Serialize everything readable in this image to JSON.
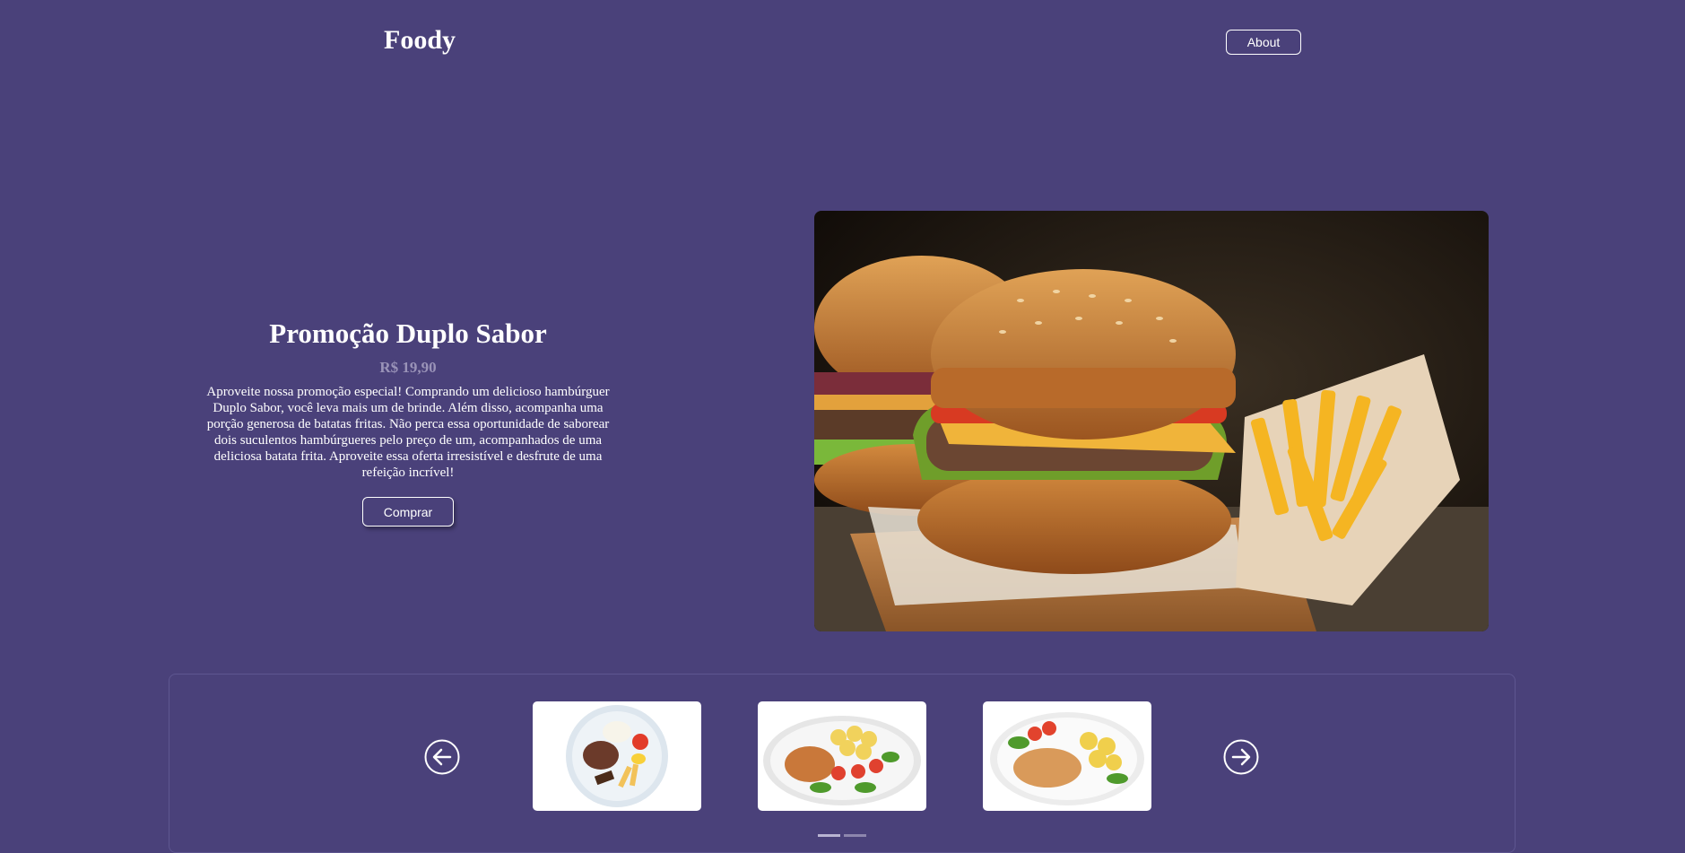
{
  "header": {
    "logo": "Foody",
    "about_label": "About"
  },
  "promo": {
    "title": "Promoção Duplo Sabor",
    "price": "R$ 19,90",
    "description": "Aproveite nossa promoção especial! Comprando um delicioso hambúrguer Duplo Sabor, você leva mais um de brinde. Além disso, acompanha uma porção generosa de batatas fritas. Não perca essa oportunidade de saborear dois suculentos hambúrgueres pelo preço de um, acompanhados de uma deliciosa batata frita. Aproveite essa oferta irresistível e desfrute de uma refeição incrível!",
    "buy_label": "Comprar"
  },
  "hero": {
    "image": "burger-with-fries-photo"
  },
  "carousel": {
    "prev_icon": "arrow-left-circle-icon",
    "next_icon": "arrow-right-circle-icon",
    "items": [
      {
        "image": "plate-beans-rice-egg-fries"
      },
      {
        "image": "plate-chicken-potatoes-salad"
      },
      {
        "image": "plate-grilled-chicken-potatoes-tomato"
      }
    ],
    "indicators": 2,
    "active_indicator": 0
  },
  "colors": {
    "background": "#4a417a",
    "text": "#ffffff",
    "price": "#9a93b8"
  }
}
